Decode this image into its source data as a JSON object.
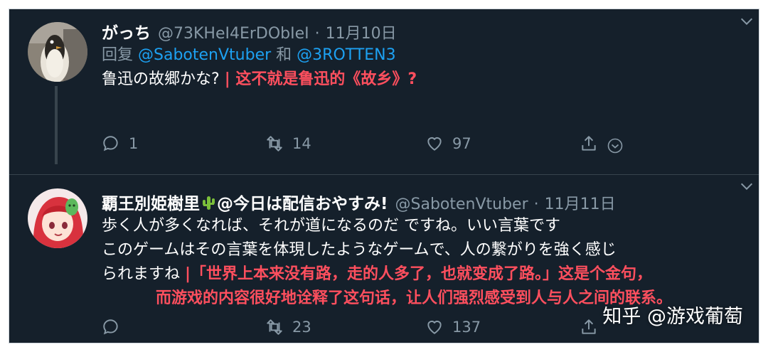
{
  "tweets": [
    {
      "name": "がっち",
      "handle": "@73KHeI4ErDObIeI",
      "separator": "·",
      "time": "11月10日",
      "reply_prefix": "回复",
      "reply_mention1": "@SabotenVtuber",
      "reply_and": "和",
      "reply_mention2": "@3ROTTEN3",
      "text": "鲁迅の故郷かな?",
      "annotation": "| 这不就是鲁迅的《故乡》?",
      "replies": "1",
      "retweets": "14",
      "likes": "97"
    },
    {
      "name_part1": "覇王別姫樹里",
      "name_part2": "@今日は配信おやすみ!",
      "handle": "@SabotenVtuber",
      "separator": "·",
      "time": "11月11日",
      "text_line1": "歩く人が多くなれば、それが道になるのだ ですね。いい言葉です",
      "text_line2": "このゲームはその言葉を体現したようなゲームで、人の繋がりを強く感じ",
      "text_line3": "られますね",
      "annotation_line1": "|「世界上本来没有路，走的人多了，也就变成了路。」这是个金句，",
      "annotation_line2": "而游戏的内容很好地诠释了这句话，让人们强烈感受到人与人之间的联系。",
      "replies": "",
      "retweets": "23",
      "likes": "137"
    }
  ],
  "watermark": "知乎 @游戏葡萄",
  "colors": {
    "background": "#15202b",
    "text": "#ffffff",
    "muted": "#8899a6",
    "link": "#1da1f2",
    "annotation": "#ff4f5e"
  },
  "icons": [
    "avatar-penguin",
    "avatar-anime-girl",
    "cactus-icon",
    "chevron-down-icon",
    "reply-icon",
    "retweet-icon",
    "like-icon",
    "share-icon",
    "dm-icon"
  ]
}
